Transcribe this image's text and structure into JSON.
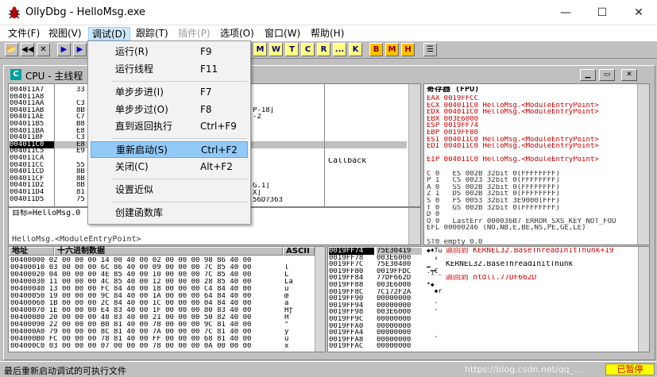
{
  "window": {
    "title": "OllyDbg - HelloMsg.exe",
    "icon": "bug-icon"
  },
  "menubar": {
    "items": [
      {
        "label": "文件(F)",
        "enabled": true
      },
      {
        "label": "视图(V)",
        "enabled": true
      },
      {
        "label": "调试(D)",
        "enabled": true,
        "active": true
      },
      {
        "label": "跟踪(T)",
        "enabled": true
      },
      {
        "label": "插件(P)",
        "enabled": false
      },
      {
        "label": "选项(O)",
        "enabled": true
      },
      {
        "label": "窗口(W)",
        "enabled": true
      },
      {
        "label": "帮助(H)",
        "enabled": true
      }
    ]
  },
  "toolbar": {
    "letters": [
      "L",
      "E",
      "M",
      "W",
      "T",
      "C",
      "R",
      "...",
      "K",
      "B",
      "M",
      "H"
    ]
  },
  "debug_menu": {
    "items": [
      {
        "label": "运行(R)",
        "shortcut": "F9"
      },
      {
        "label": "运行线程",
        "shortcut": "F11"
      },
      {
        "label": "单步步进(I)",
        "shortcut": "F7"
      },
      {
        "label": "单步步过(O)",
        "shortcut": "F8"
      },
      {
        "label": "直到返回执行",
        "shortcut": "Ctrl+F9"
      },
      {
        "label": "重新启动(S)",
        "shortcut": "Ctrl+F2",
        "highlighted": true
      },
      {
        "label": "关闭(C)",
        "shortcut": "Alt+F2"
      },
      {
        "label": "设置近似",
        "shortcut": ""
      },
      {
        "label": "创建函数库",
        "shortcut": ""
      }
    ]
  },
  "cpu": {
    "title": "CPU - 主线程",
    "disasm_addrs": [
      "004011A7",
      "004011A8",
      "004011AA",
      "004011AB",
      "004011AE",
      "004011B5",
      "004011BA",
      "004011BF",
      "004011C0",
      "004011C5",
      "004011CA",
      "004011CC",
      "004011CD",
      "004011CF",
      "004011D2",
      "004011D4",
      "004011D5"
    ],
    "disasm_bytes": [
      "33",
      "",
      "C3",
      "8B",
      "C7",
      "B8",
      "E8",
      "C3",
      "E8",
      "E9",
      "",
      "55",
      "8B",
      "8B",
      "8B",
      "81",
      "75"
    ],
    "disasm_selected": 8,
    "disasm_frag": [
      "",
      "",
      "",
      "P-18]",
      "-2",
      "",
      "",
      "",
      "",
      "",
      "",
      "",
      "",
      "",
      "",
      "",
      ""
    ],
    "comment": "Callback",
    "extra": [
      "G.1]",
      "X]",
      "56D7363"
    ],
    "info1": "目标=HelloMsg.0",
    "info2": "HelloMsg.<ModuleEntryPoint>"
  },
  "registers": {
    "header": "寄存器 (FPU)",
    "rows": [
      "EAX 0019FFCC",
      "ECX 004011C0 HelloMsg.<ModuleEntryPoint>",
      "EDX 004011C0 HelloMsg.<ModuleEntryPoint>",
      "EBX 003E6000",
      "ESP 0019FF74",
      "EBP 0019FF80",
      "ESI 004011C0 HelloMsg.<ModuleEntryPoint>",
      "EDI 004011C0 HelloMsg.<ModuleEntryPoint>",
      "",
      "EIP 004011C0 HelloMsg.<ModuleEntryPoint>",
      "",
      "C 0   ES 002B 32bit 0(FFFFFFFF)",
      "P 1   CS 0023 32bit 0(FFFFFFFF)",
      "A 0   SS 002B 32bit 0(FFFFFFFF)",
      "Z 1   DS 002B 32bit 0(FFFFFFFF)",
      "S 0   FS 0053 32bit 3E9000(FFF)",
      "T 0   GS 002B 32bit 0(FFFFFFFF)",
      "D 0",
      "O 0   LastErr 000036B7 ERROR_SXS_KEY_NOT_FOU",
      "EFL 00000246 (NO,NB,E,BE,NS,PE,GE,LE)",
      "",
      "ST0 empty 0.0"
    ]
  },
  "dump": {
    "addr_header": "地址",
    "hex_header": "十六进制数据",
    "ascii_header": "ASCII",
    "rows": [
      "00400000 02 00 00 00 14 00 40 00 02 00 00 00 98 86 40 00",
      "00400010 03 00 00 00 6C 86 40 00 09 00 00 00 7C 85 40 00",
      "00400020 04 00 00 00 4E 85 40 00 10 00 00 00 7C 85 40 00",
      "00400030 11 00 00 00 4C 85 40 00 12 00 00 00 28 85 40 00",
      "00400040 13 00 00 00 FC 84 40 00 18 00 00 00 C4 84 40 00",
      "00400050 19 00 00 00 9C 84 40 00 1A 00 00 00 64 84 40 00",
      "00400060 1B 00 00 00 2C 84 40 00 1C 00 00 00 04 84 40 00",
      "00400070 1E 00 00 00 E4 83 40 00 1F 00 00 00 80 83 40 00",
      "00400080 20 00 00 00 48 83 40 00 21 00 00 00 50 82 40 00",
      "00400090 22 00 00 00 B0 81 40 00 78 00 00 00 9C 81 40 00",
      "004000A0 79 00 00 00 8C 81 40 00 7A 00 00 00 7C 81 40 00",
      "004000B0 FC 00 00 00 78 81 40 00 FF 00 00 00 68 81 40 00",
      "004000C0 03 00 00 00 07 00 00 00 78 00 00 00 0A 00 00 00"
    ],
    "ascii": [
      "",
      "l",
      "L",
      "Là",
      "ü",
      "œ",
      "ä",
      "Hƒ",
      "H",
      "°",
      "y",
      "ü",
      "x"
    ]
  },
  "stack": {
    "addrs": [
      "0019FF74",
      "0019FF78",
      "0019FF7C",
      "0019FF80",
      "0019FF84",
      "0019FF88",
      "0019FF8C",
      "0019FF90",
      "0019FF94",
      "0019FF98",
      "0019FF9C",
      "0019FFA0",
      "0019FFA4",
      "0019FFA8",
      "0019FFAC"
    ],
    "vals": [
      "75E30419",
      "003E6000",
      "75E30400",
      "0019FFDC",
      "77DF662D",
      "003E6000",
      "7C172F2A",
      "00000000",
      "00000000",
      "003E6000",
      "00000000",
      "00000000",
      "00000000",
      "00000000",
      "00000000"
    ],
    "selected": 0,
    "comments": [
      {
        "text": "返回到 KERNEL32.BaseThreadInitThunk+19",
        "color": "#d40000"
      },
      {
        "text": "KERNEL32.BaseThreadInitThunk",
        "color": "#000000"
      },
      {
        "text": "",
        "color": "#000000"
      },
      {
        "text": "返回到 ntdll.77DF662D",
        "color": "#d40000"
      }
    ]
  },
  "status": {
    "text": "最后重新启动调试的可执行文件",
    "badge": "已暂停",
    "watermark": "https://blog.csdn.net/qq_..."
  }
}
